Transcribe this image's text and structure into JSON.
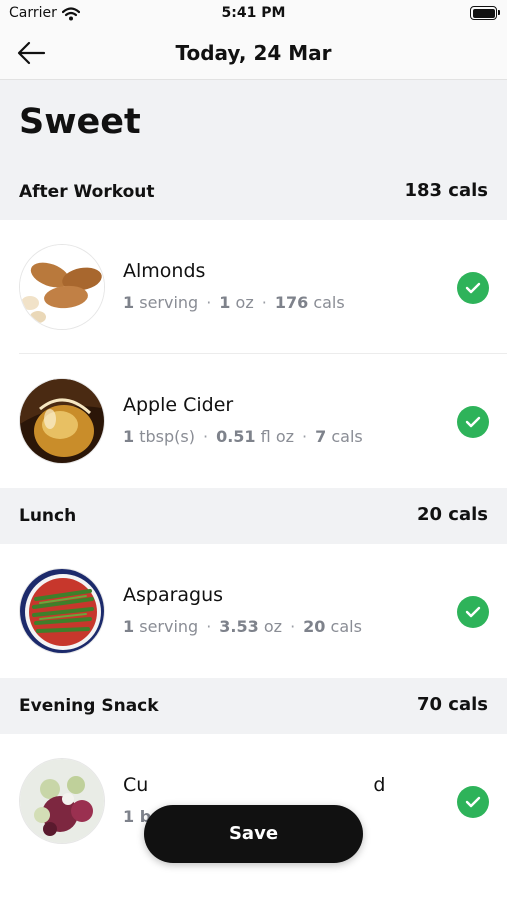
{
  "status_bar": {
    "carrier": "Carrier",
    "time": "5:41 PM",
    "icons": [
      "wifi-icon",
      "battery-icon"
    ]
  },
  "nav": {
    "title": "Today, 24 Mar",
    "back_icon": "arrow-left-icon"
  },
  "page_title": "Sweet",
  "sections": [
    {
      "name": "After Workout",
      "cals": "183 cals",
      "items": [
        {
          "name": "Almonds",
          "quantity": "1",
          "unit": "serving",
          "weight_value": "1",
          "weight_unit": "oz",
          "cals_value": "176",
          "cals_unit": "cals",
          "checked": true
        },
        {
          "name": "Apple Cider",
          "quantity": "1",
          "unit": "tbsp(s)",
          "weight_value": "0.51",
          "weight_unit": "fl oz",
          "cals_value": "7",
          "cals_unit": "cals",
          "checked": true
        }
      ]
    },
    {
      "name": "Lunch",
      "cals": "20 cals",
      "items": [
        {
          "name": "Asparagus",
          "quantity": "1",
          "unit": "serving",
          "weight_value": "3.53",
          "weight_unit": "oz",
          "cals_value": "20",
          "cals_unit": "cals",
          "checked": true
        }
      ]
    },
    {
      "name": "Evening Snack",
      "cals": "70 cals",
      "items": [
        {
          "name": "Cu",
          "name_tail": "d",
          "quantity": "1 b",
          "checked": true
        }
      ]
    }
  ],
  "save_button": {
    "label": "Save"
  },
  "colors": {
    "check_green": "#2eb35a",
    "section_bg": "#f1f2f4",
    "save_bg": "#111111",
    "meta_text": "#8a8d95"
  }
}
